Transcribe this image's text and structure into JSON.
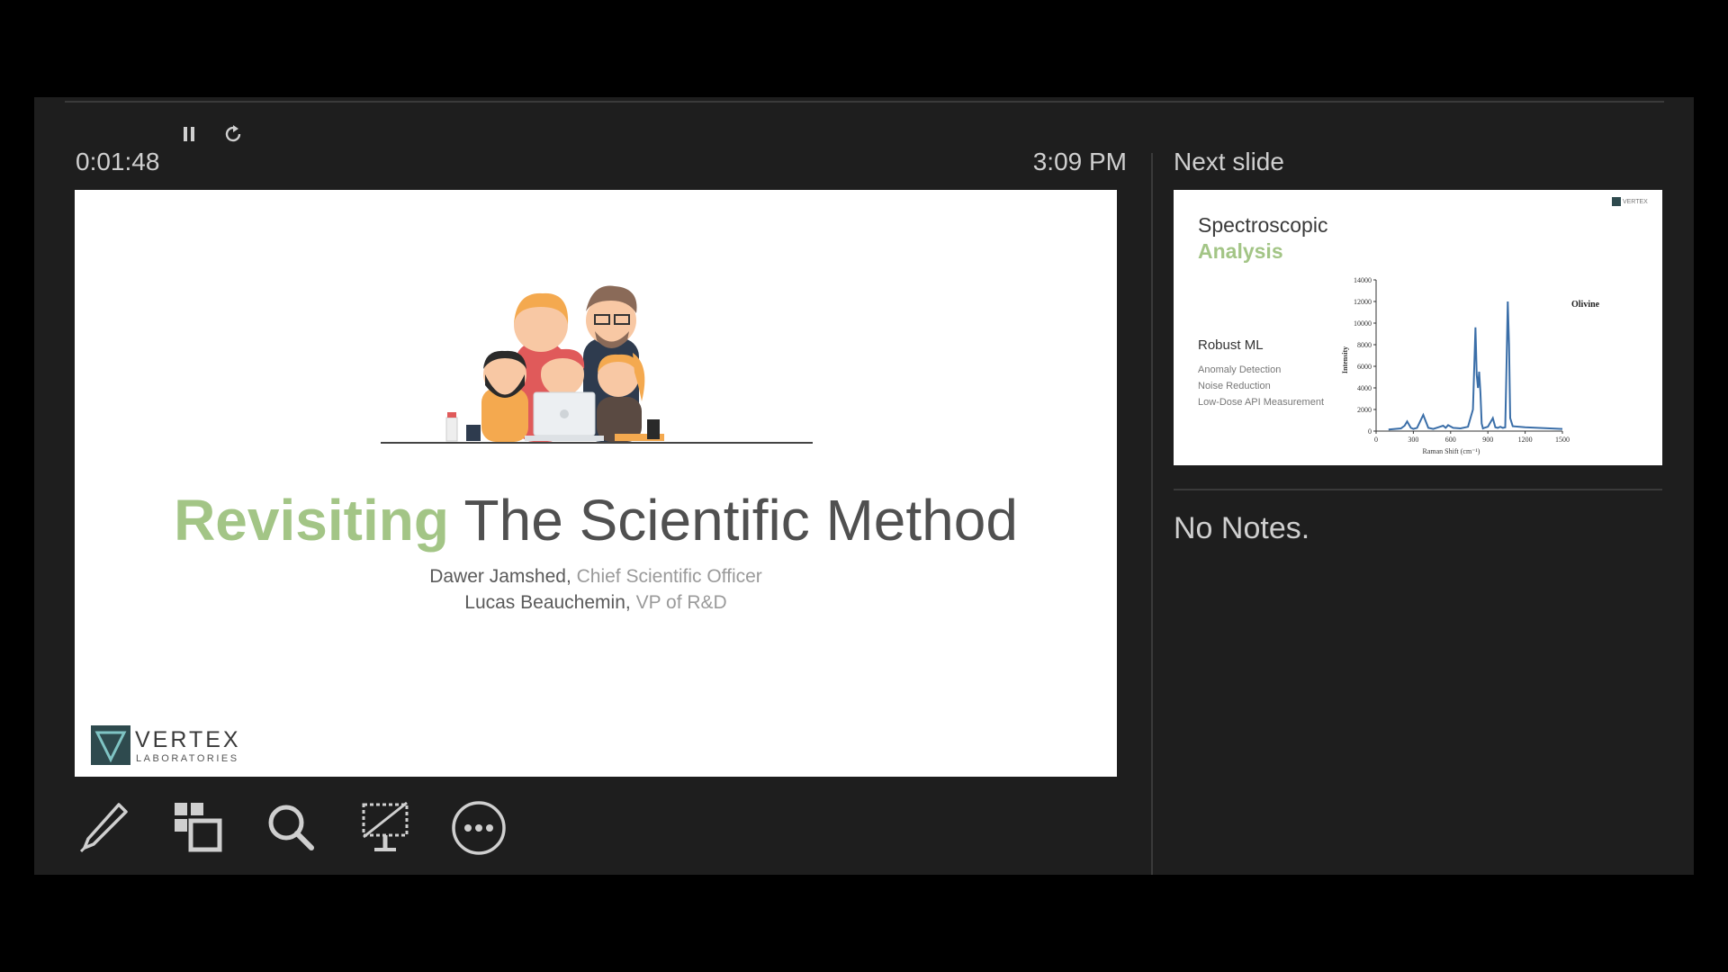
{
  "presenter_view": {
    "timer": "0:01:48",
    "clock": "3:09 PM",
    "next_slide_label": "Next slide",
    "notes_text": "No Notes."
  },
  "current_slide": {
    "title_highlight": "Revisiting",
    "title_rest": "The Scientific Method",
    "presenters": [
      {
        "name": "Dawer Jamshed",
        "sep": ", ",
        "role": "Chief Scientific Officer"
      },
      {
        "name": "Lucas Beauchemin",
        "sep": ", ",
        "role": "VP of R&D"
      }
    ],
    "logo": {
      "name": "VERTEX",
      "sub": "LABORATORIES"
    }
  },
  "next_slide": {
    "title_line1": "Spectroscopic",
    "title_line2": "Analysis",
    "subtitle": "Robust ML",
    "items": [
      "Anomaly Detection",
      "Noise Reduction",
      "Low-Dose API Measurement"
    ],
    "logo_text": "VERTEX"
  },
  "chart_data": {
    "type": "line",
    "xlabel": "Raman Shift (cm⁻¹)",
    "ylabel": "Intensity",
    "xlim": [
      0,
      1500
    ],
    "ylim": [
      0,
      14000
    ],
    "xticks": [
      0,
      300,
      600,
      900,
      1200,
      1500
    ],
    "yticks": [
      0,
      2000,
      4000,
      6000,
      8000,
      10000,
      12000,
      14000
    ],
    "annotation": "Olivine",
    "series": [
      {
        "x": [
          100,
          200,
          230,
          250,
          280,
          300,
          330,
          380,
          420,
          460,
          500,
          540,
          560,
          580,
          620,
          680,
          740,
          780,
          800,
          810,
          820,
          830,
          840,
          850,
          860,
          870,
          900,
          940,
          960,
          980,
          1000,
          1020,
          1040,
          1050,
          1060,
          1070,
          1080,
          1100,
          1200,
          1300,
          1400,
          1500
        ],
        "y": [
          150,
          250,
          500,
          900,
          300,
          200,
          300,
          1500,
          300,
          200,
          350,
          500,
          300,
          550,
          300,
          250,
          400,
          2000,
          9600,
          5200,
          4000,
          5500,
          3600,
          700,
          250,
          300,
          400,
          1200,
          350,
          300,
          400,
          300,
          350,
          6000,
          12000,
          8000,
          1200,
          450,
          350,
          300,
          250,
          200
        ],
        "color": "#3a6ea8"
      }
    ]
  }
}
